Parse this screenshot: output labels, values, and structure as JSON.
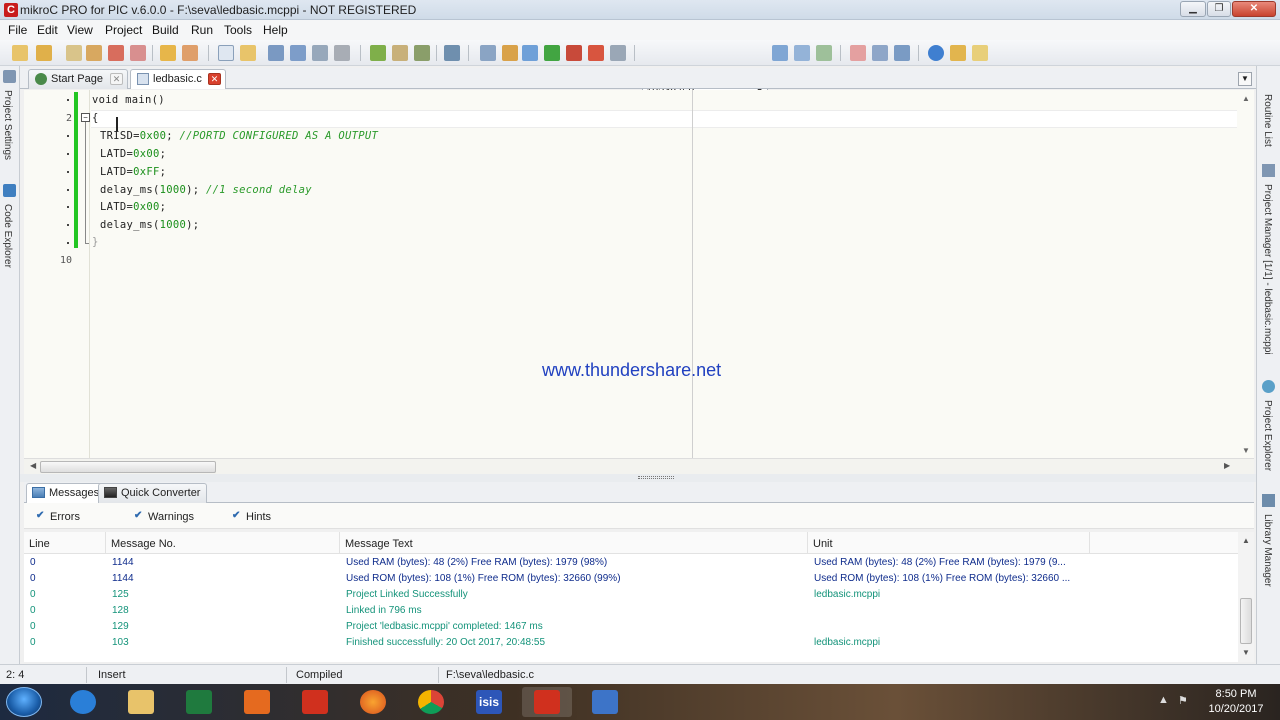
{
  "window": {
    "title": "mikroC PRO for PIC v.6.0.0 - F:\\seva\\ledbasic.mcppi - NOT REGISTERED"
  },
  "menu": [
    "File",
    "Edit",
    "View",
    "Project",
    "Build",
    "Run",
    "Tools",
    "Help"
  ],
  "toolbar": {
    "resolution": "1024x768"
  },
  "left_panel": {
    "tabs": [
      "Project Settings",
      "Code Explorer"
    ]
  },
  "right_panel": {
    "tabs": [
      "Routine List",
      "Project Manager [1/1] - ledbasic.mcppi",
      "Project Explorer",
      "Library Manager"
    ]
  },
  "doc_tabs": [
    {
      "label": "Start Page"
    },
    {
      "label": "ledbasic.c"
    }
  ],
  "editor": {
    "line_numbers": {
      "l2": "2",
      "l10": "10"
    },
    "code": {
      "l1": "void main()",
      "l2": "{",
      "l3_a": "TRISD=",
      "l3_num": "0x00",
      "l3_b": ";",
      "l3_cmt": "//PORTD CONFIGURED AS A OUTPUT",
      "l4_a": "LATD=",
      "l4_num": "0x00",
      "l4_b": ";",
      "l5_a": "LATD=",
      "l5_num": "0xFF",
      "l5_b": ";",
      "l6_a": "delay_ms(",
      "l6_num": "1000",
      "l6_b": ");",
      "l6_cmt": "//1 second delay",
      "l7_a": "LATD=",
      "l7_num": "0x00",
      "l7_b": ";",
      "l8_a": "delay_ms(",
      "l8_num": "1000",
      "l8_b": ");",
      "l9": "}"
    },
    "watermark": "www.thundershare.net"
  },
  "messages": {
    "tabs": [
      "Messages",
      "Quick Converter"
    ],
    "filters": [
      "Errors",
      "Warnings",
      "Hints"
    ],
    "columns": [
      "Line",
      "Message No.",
      "Message Text",
      "Unit"
    ],
    "rows": [
      {
        "line": "0",
        "no": "1144",
        "text": "Used RAM (bytes): 48 (2%)  Free RAM (bytes): 1979 (98%)",
        "unit": "Used RAM (bytes): 48 (2%)  Free RAM (bytes): 1979 (9..."
      },
      {
        "line": "0",
        "no": "1144",
        "text": "Used ROM (bytes): 108 (1%)  Free ROM (bytes): 32660 (99%)",
        "unit": "Used ROM (bytes): 108 (1%)  Free ROM (bytes): 32660 ..."
      },
      {
        "line": "0",
        "no": "125",
        "text": "Project Linked Successfully",
        "unit": "ledbasic.mcppi"
      },
      {
        "line": "0",
        "no": "128",
        "text": "Linked in 796 ms",
        "unit": ""
      },
      {
        "line": "0",
        "no": "129",
        "text": "Project 'ledbasic.mcppi' completed: 1467 ms",
        "unit": ""
      },
      {
        "line": "0",
        "no": "103",
        "text": "Finished successfully: 20 Oct 2017, 20:48:55",
        "unit": "ledbasic.mcppi"
      }
    ]
  },
  "status": {
    "position": "2: 4",
    "mode": "Insert",
    "state": "Compiled",
    "file": "F:\\seva\\ledbasic.c"
  },
  "taskbar": {
    "time": "8:50 PM",
    "date": "10/20/2017",
    "isis_label": "isis"
  }
}
